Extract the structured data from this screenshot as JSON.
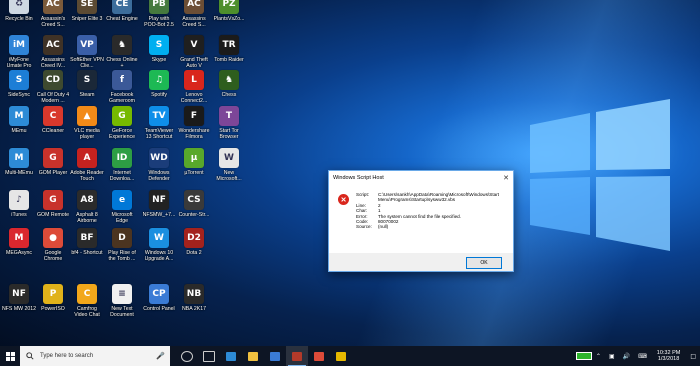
{
  "desktop_icons": [
    {
      "label": "Recycle Bin",
      "short": "♻",
      "color": "#cfd8e2"
    },
    {
      "label": "Assassin's Creed S...",
      "short": "AC",
      "color": "#7b5a3a"
    },
    {
      "label": "Sniper Elite 3",
      "short": "SE",
      "color": "#5b4a33"
    },
    {
      "label": "Cheat Engine",
      "short": "CE",
      "color": "#3c6d9b"
    },
    {
      "label": "Play with POO-Bot 2.5",
      "short": "PB",
      "color": "#467a3e"
    },
    {
      "label": "Assassins Creed S...",
      "short": "AC",
      "color": "#6c4e35"
    },
    {
      "label": "PlantsVsZo...",
      "short": "PZ",
      "color": "#4e8f2c"
    },
    {
      "label": "iMyFone Umate Pro",
      "short": "iM",
      "color": "#2f84d8"
    },
    {
      "label": "Assassins Creed IV...",
      "short": "AC",
      "color": "#3f3226"
    },
    {
      "label": "SoftEther VPN Clie...",
      "short": "VP",
      "color": "#3a5fa8"
    },
    {
      "label": "Chess Online +",
      "short": "♞",
      "color": "#2a2a2a"
    },
    {
      "label": "Skype",
      "short": "S",
      "color": "#00aff0"
    },
    {
      "label": "Grand Theft Auto V",
      "short": "V",
      "color": "#1f1f1f"
    },
    {
      "label": "Tomb Raider",
      "short": "TR",
      "color": "#1b1b1b"
    },
    {
      "label": "SideSync",
      "short": "S",
      "color": "#1c7ed6"
    },
    {
      "label": "Call Of Duty 4 Modern ...",
      "short": "CD",
      "color": "#3e4a2f"
    },
    {
      "label": "Steam",
      "short": "S",
      "color": "#1b2838"
    },
    {
      "label": "Facebook Gameroom",
      "short": "f",
      "color": "#3b5998"
    },
    {
      "label": "Spotify",
      "short": "♫",
      "color": "#1db954"
    },
    {
      "label": "Lenovo Connect2...",
      "short": "L",
      "color": "#d9261c"
    },
    {
      "label": "Chess",
      "short": "♞",
      "color": "#2e5e1e"
    },
    {
      "label": "MEmu",
      "short": "M",
      "color": "#2d8bd6"
    },
    {
      "label": "CCleaner",
      "short": "C",
      "color": "#d9382c"
    },
    {
      "label": "VLC media player",
      "short": "▲",
      "color": "#f28a18"
    },
    {
      "label": "GeForce Experience",
      "short": "G",
      "color": "#76b900"
    },
    {
      "label": "TeamViewer 13 Shortcut",
      "short": "TV",
      "color": "#0e8ee9"
    },
    {
      "label": "Wondershare Filmora",
      "short": "F",
      "color": "#1a1a1a"
    },
    {
      "label": "Start Tor Browser",
      "short": "T",
      "color": "#7d4698"
    },
    {
      "label": "Multi-MEmu",
      "short": "M",
      "color": "#2d8bd6"
    },
    {
      "label": "GOM Player",
      "short": "G",
      "color": "#c8322b"
    },
    {
      "label": "Adobe Reader Touch",
      "short": "A",
      "color": "#c5221f"
    },
    {
      "label": "Internet Downloa...",
      "short": "ID",
      "color": "#2d9e44"
    },
    {
      "label": "Windows Defender",
      "short": "WD",
      "color": "#1b3d7a"
    },
    {
      "label": "µTorrent",
      "short": "µ",
      "color": "#58a82b"
    },
    {
      "label": "New Microsoft...",
      "short": "W",
      "color": "#e6e6e6"
    },
    {
      "label": "iTunes",
      "short": "♪",
      "color": "#e6e6e6"
    },
    {
      "label": "GOM Remote",
      "short": "G",
      "color": "#c8322b"
    },
    {
      "label": "Asphalt 8 Airborne",
      "short": "A8",
      "color": "#2b2b2b"
    },
    {
      "label": "Microsoft Edge",
      "short": "e",
      "color": "#0078d7"
    },
    {
      "label": "NFSMW_+7...",
      "short": "NF",
      "color": "#222222"
    },
    {
      "label": "Counter-Str...",
      "short": "CS",
      "color": "#3a3a3a"
    },
    {
      "label": "MEGAsync",
      "short": "M",
      "color": "#d9272e"
    },
    {
      "label": "Google Chrome",
      "short": "●",
      "color": "#dd4b39"
    },
    {
      "label": "bf4 - Shortcut",
      "short": "BF",
      "color": "#2a2a2a"
    },
    {
      "label": "Play Rise of the Tomb ...",
      "short": "D",
      "color": "#4b3420"
    },
    {
      "label": "Windows 10 Upgrade A...",
      "short": "W",
      "color": "#1a8fe0"
    },
    {
      "label": "Dota 2",
      "short": "D2",
      "color": "#a3221d"
    },
    {
      "label": "NFS MW 2012",
      "short": "NF",
      "color": "#2a2a2a"
    },
    {
      "label": "PowerISO",
      "short": "P",
      "color": "#e0b21a"
    },
    {
      "label": "Camfrog Video Chat",
      "short": "C",
      "color": "#f2a71a"
    },
    {
      "label": "New Text Document",
      "short": "≡",
      "color": "#f0f0f0"
    },
    {
      "label": "Control Panel",
      "short": "CP",
      "color": "#3a7bd5"
    },
    {
      "label": "NBA 2K17",
      "short": "NB",
      "color": "#2a2a2a"
    }
  ],
  "dialog": {
    "title": "Windows Script Host",
    "close": "✕",
    "error_icon": "✕",
    "lines": [
      {
        "k": "Script:",
        "v": "C:\\Users\\sankh\\AppData\\Roaming\\Microsoft\\Windows\\Start"
      },
      {
        "k": "",
        "v": "Menu\\Programs\\Startup\\sysww32.vbs"
      },
      {
        "k": "Line:",
        "v": "2"
      },
      {
        "k": "Char:",
        "v": "1"
      },
      {
        "k": "Error:",
        "v": "The system cannot find the file specified."
      },
      {
        "k": "Code:",
        "v": "80070002"
      },
      {
        "k": "Source:",
        "v": "(null)"
      }
    ],
    "ok_label": "OK"
  },
  "taskbar": {
    "search_placeholder": "Type here to search",
    "apps": [
      {
        "name": "cortana-icon",
        "color": "#cccccc"
      },
      {
        "name": "task-view-icon",
        "color": "#cccccc"
      },
      {
        "name": "edge-icon",
        "color": "#2d8bd6"
      },
      {
        "name": "file-explorer-icon",
        "color": "#f0c040"
      },
      {
        "name": "store-icon",
        "color": "#3a7bd5"
      },
      {
        "name": "wsh-icon",
        "color": "#b33a2a"
      },
      {
        "name": "chrome-icon",
        "color": "#dd4b39"
      },
      {
        "name": "store-bag-icon",
        "color": "#e6b800"
      }
    ],
    "time": "10:32 PM",
    "date": "1/3/2018"
  }
}
